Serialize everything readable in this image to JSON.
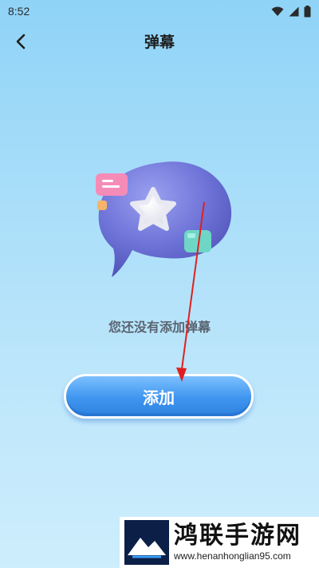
{
  "status_bar": {
    "time": "8:52",
    "icons": [
      "wifi-icon",
      "signal-icon",
      "battery-icon"
    ]
  },
  "header": {
    "back_icon": "back-arrow-icon",
    "title": "弹幕"
  },
  "empty_state": {
    "illustration": "speech-bubble-star-illustration",
    "message": "您还没有添加弹幕"
  },
  "actions": {
    "add_label": "添加"
  },
  "watermark": {
    "name": "鸿联手游网",
    "url": "www.henanhonglian95.com"
  },
  "colors": {
    "accent": "#3f95ef",
    "bubble": "#6f74d8",
    "arrow": "#e02020"
  }
}
